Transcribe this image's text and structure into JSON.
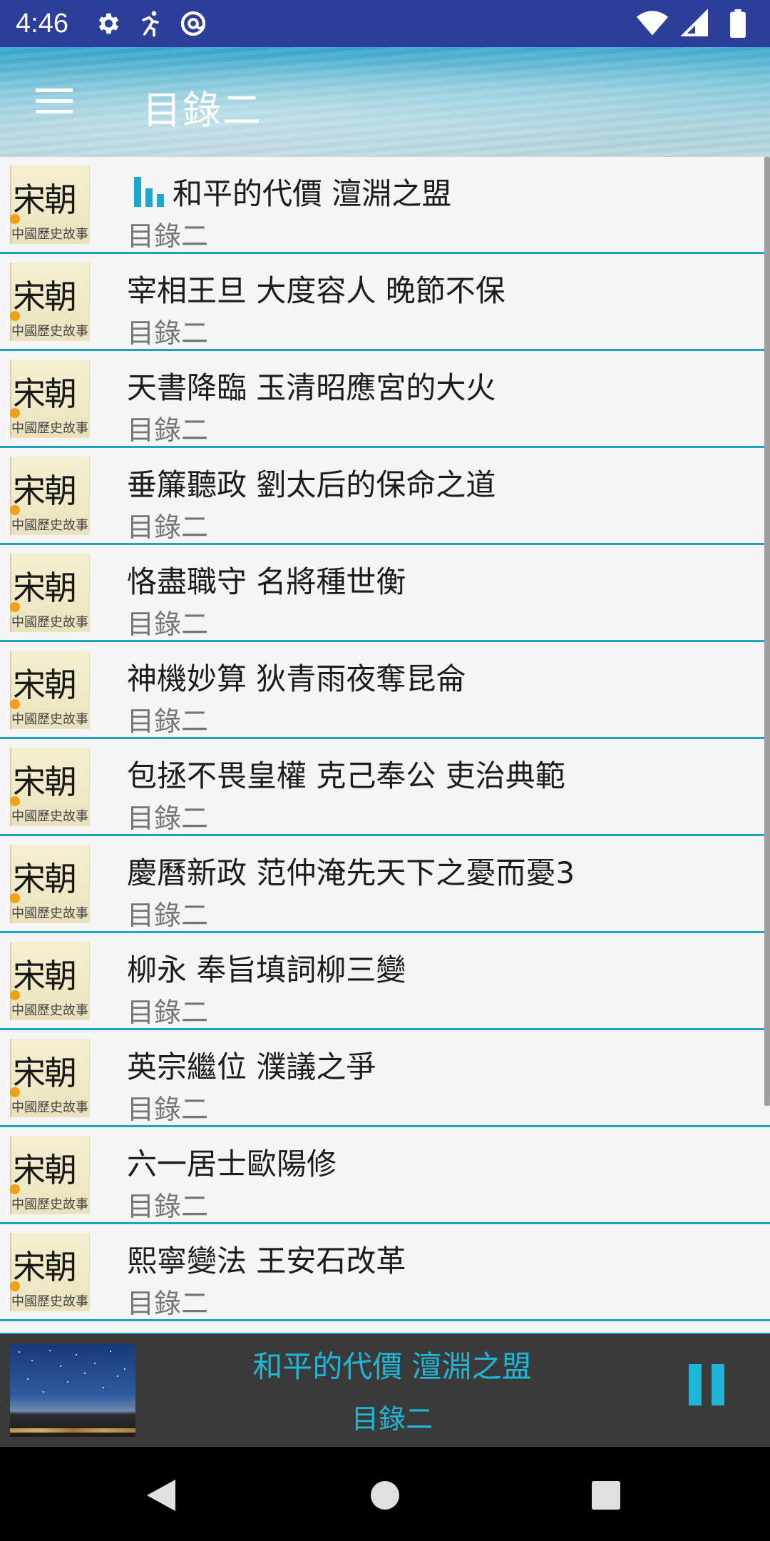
{
  "status_bar": {
    "time": "4:46",
    "icons_left": [
      "gear-icon",
      "runner-icon",
      "at-sign-icon"
    ],
    "icons_right": [
      "wifi-icon",
      "signal-icon",
      "battery-icon"
    ]
  },
  "app_bar": {
    "title": "目錄二"
  },
  "list": {
    "cover_big_text": "宋朝",
    "cover_small_text": "中國歷史故事",
    "items": [
      {
        "title": "和平的代價 澶淵之盟",
        "subtitle": "目錄二",
        "playing": true
      },
      {
        "title": "宰相王旦 大度容人 晚節不保",
        "subtitle": "目錄二"
      },
      {
        "title": "天書降臨 玉清昭應宮的大火",
        "subtitle": "目錄二"
      },
      {
        "title": "垂簾聽政 劉太后的保命之道",
        "subtitle": "目錄二"
      },
      {
        "title": "恪盡職守 名將種世衡",
        "subtitle": "目錄二"
      },
      {
        "title": "神機妙算 狄青雨夜奪昆侖",
        "subtitle": "目錄二"
      },
      {
        "title": "包拯不畏皇權 克己奉公 吏治典範",
        "subtitle": "目錄二"
      },
      {
        "title": "慶曆新政 范仲淹先天下之憂而憂3",
        "subtitle": "目錄二"
      },
      {
        "title": "柳永 奉旨填詞柳三變",
        "subtitle": "目錄二"
      },
      {
        "title": "英宗繼位 濮議之爭",
        "subtitle": "目錄二"
      },
      {
        "title": "六一居士歐陽修",
        "subtitle": "目錄二"
      },
      {
        "title": "熙寧變法 王安石改革",
        "subtitle": "目錄二"
      }
    ]
  },
  "mini_player": {
    "title": "和平的代價 澶淵之盟",
    "subtitle": "目錄二"
  },
  "colors": {
    "status_bar": "#2d3e9a",
    "accent": "#1da1c4",
    "player_bg": "#3a3a3a"
  }
}
